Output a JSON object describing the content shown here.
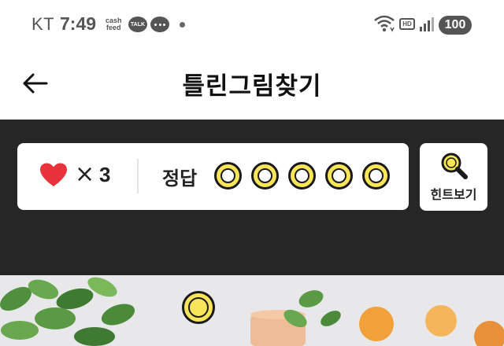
{
  "status_bar": {
    "carrier": "KT",
    "time": "7:49",
    "cashfeed_line1": "cash",
    "cashfeed_line2": "feed",
    "talk": "TALK",
    "hd": "HD",
    "battery": "100"
  },
  "app_bar": {
    "title": "틀린그림찾기"
  },
  "game": {
    "times_sign": "×",
    "lives": "3",
    "answer_label": "정답",
    "answer_slots_total": 5,
    "hint_label": "힌트보기"
  },
  "colors": {
    "accent_yellow": "#f8e55a",
    "heart_red": "#e8333c",
    "dark_bg": "#262626"
  }
}
